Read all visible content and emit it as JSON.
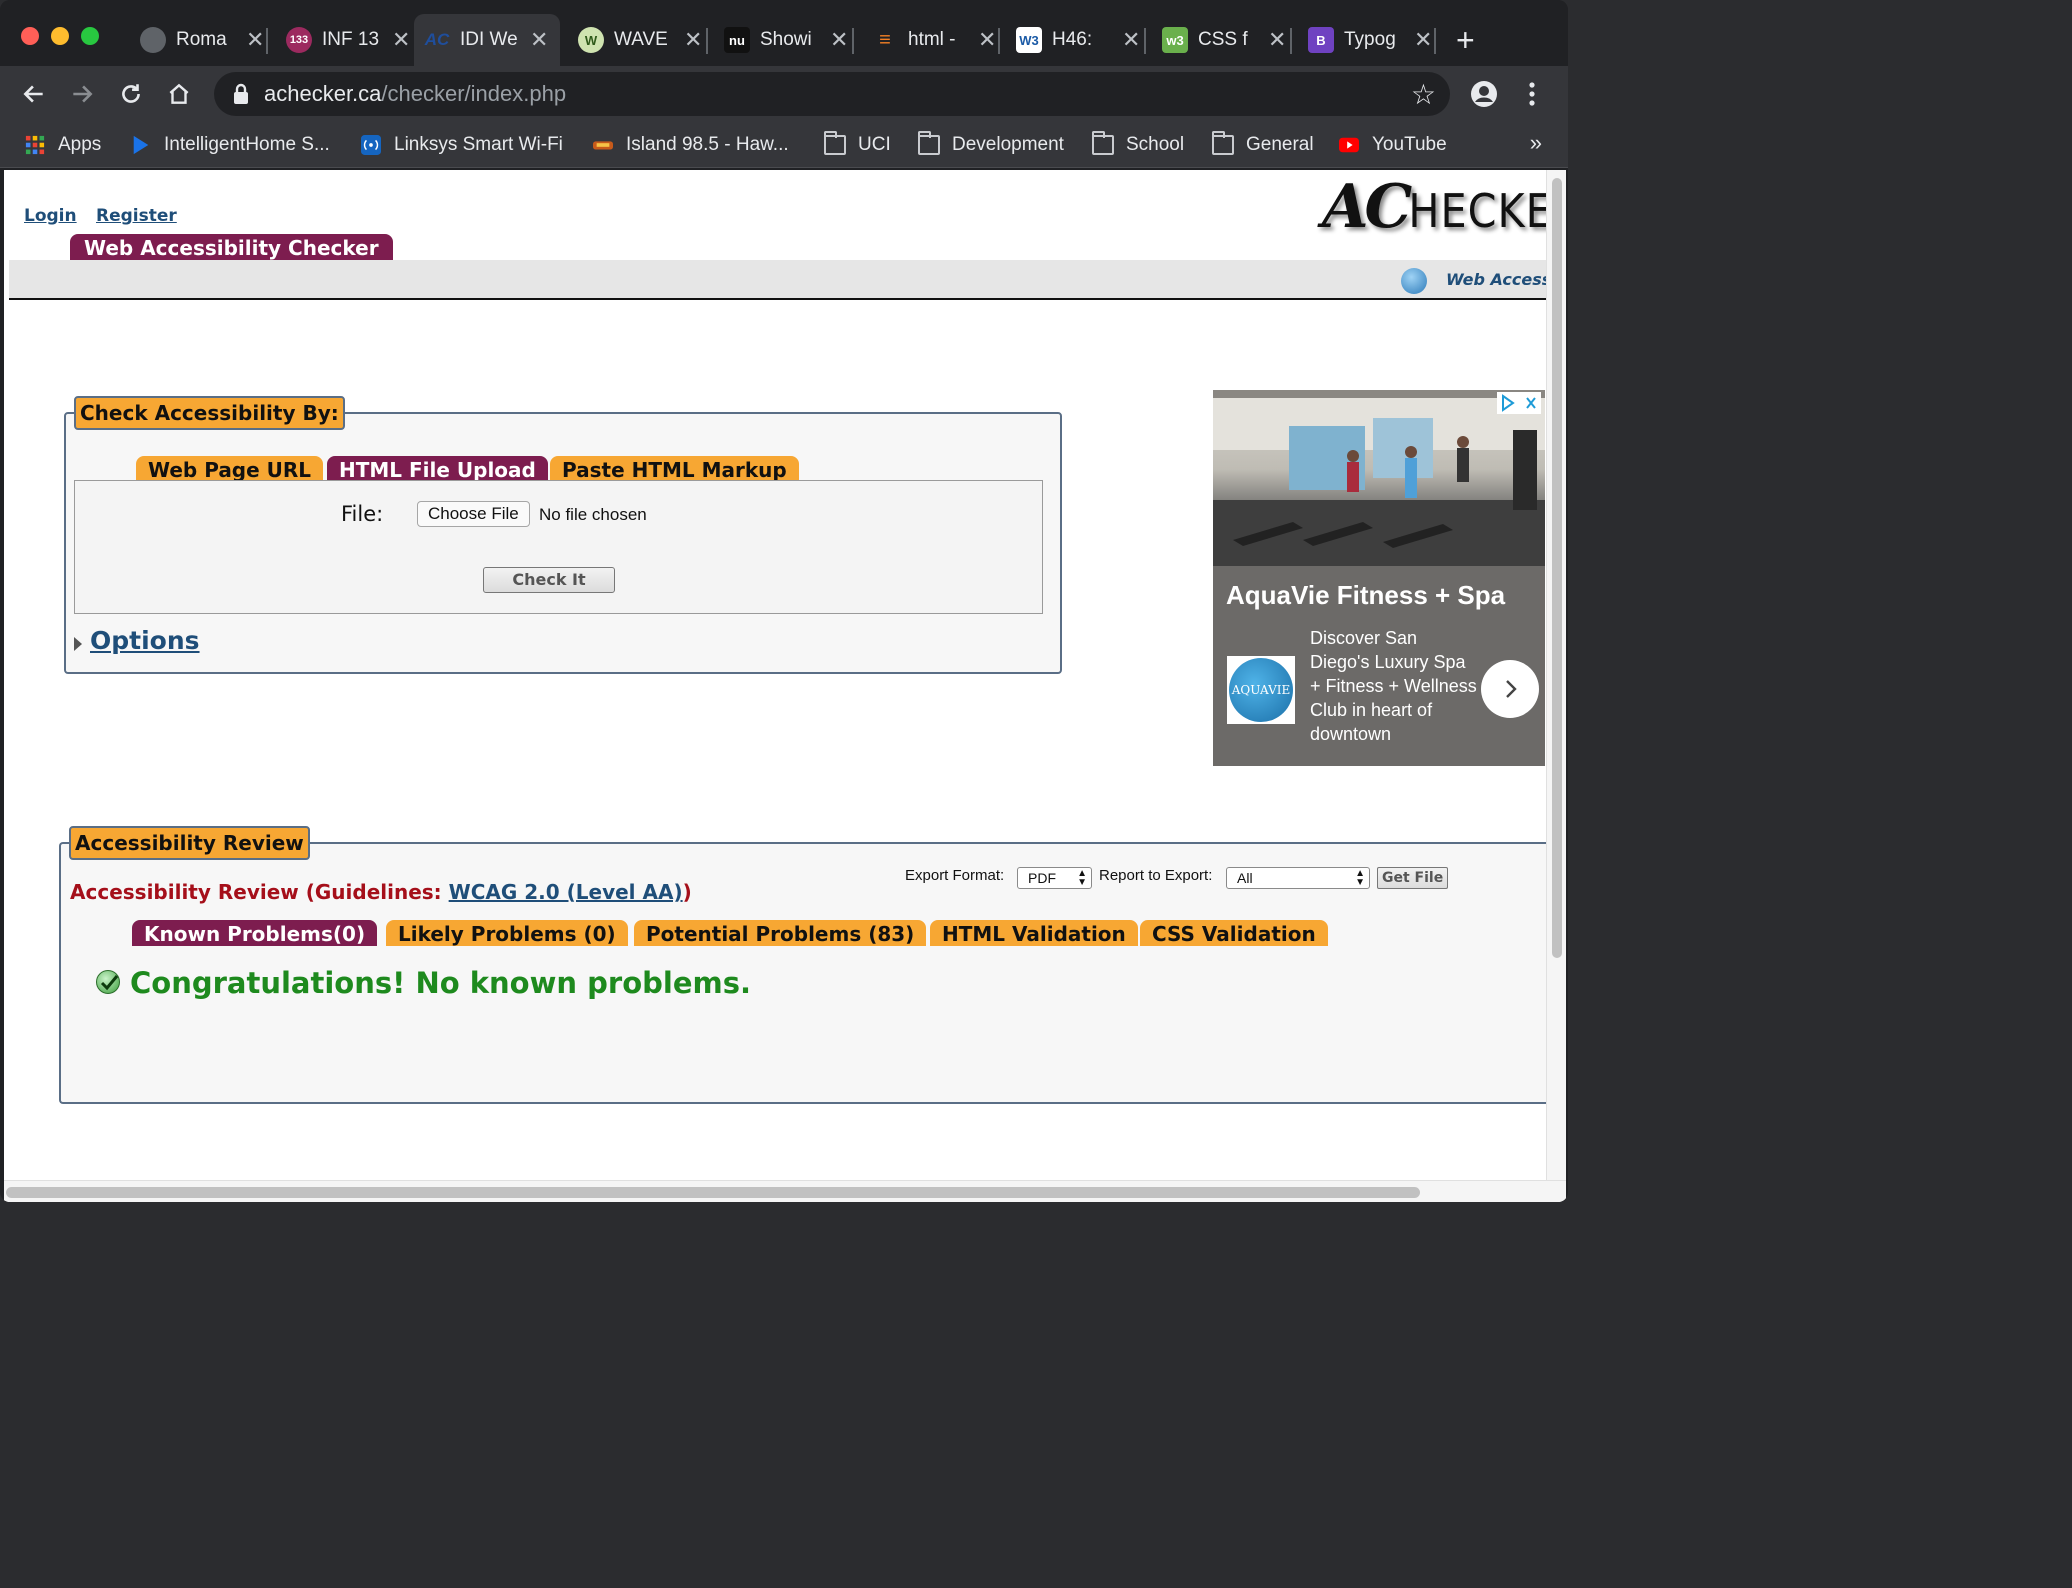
{
  "browser": {
    "tabs": [
      {
        "title": "Roma",
        "favicon": "globe-icon"
      },
      {
        "title": "INF 13",
        "favicon": "133-badge-icon",
        "badge": "133"
      },
      {
        "title": "IDI We",
        "favicon": "achecker-icon",
        "badge": "AC",
        "active": true
      },
      {
        "title": "WAVE",
        "favicon": "wave-icon",
        "badge": "W"
      },
      {
        "title": "Showi",
        "favicon": "nu-icon",
        "badge": "nu"
      },
      {
        "title": "html -",
        "favicon": "stackoverflow-icon"
      },
      {
        "title": "H46:",
        "favicon": "w3c-icon",
        "badge": "W3"
      },
      {
        "title": "CSS f",
        "favicon": "css-validator-icon",
        "badge": "w3"
      },
      {
        "title": "Typog",
        "favicon": "bootstrap-icon",
        "badge": "B"
      }
    ],
    "url_host": "achecker.ca",
    "url_path": "/checker/index.php",
    "bookmarks": [
      {
        "label": "Apps",
        "icon": "apps-grid-icon"
      },
      {
        "label": "IntelligentHome S...",
        "icon": "play-arrow-icon"
      },
      {
        "label": "Linksys Smart Wi-Fi",
        "icon": "wifi-icon"
      },
      {
        "label": "Island 98.5 - Haw...",
        "icon": "radio-icon"
      },
      {
        "label": "UCI",
        "icon": "folder-icon"
      },
      {
        "label": "Development",
        "icon": "folder-icon"
      },
      {
        "label": "School",
        "icon": "folder-icon"
      },
      {
        "label": "General",
        "icon": "folder-icon"
      },
      {
        "label": "YouTube",
        "icon": "youtube-icon"
      }
    ],
    "bookmarks_more": "»"
  },
  "page": {
    "login": "Login",
    "register": "Register",
    "logo_big": "AC",
    "logo_rest": "HECKE",
    "site_tab": "Web Accessibility Checker",
    "help_link": "Web Accessil",
    "check_legend": "Check Accessibility By:",
    "check_tabs": [
      "Web Page URL",
      "HTML File Upload",
      "Paste HTML Markup"
    ],
    "file_label": "File:",
    "choose_file": "Choose File",
    "no_file": "No file chosen",
    "check_it": "Check It",
    "options": "Options",
    "ad": {
      "title": "AquaVie Fitness + Spa",
      "logo_text": "AQUAVIE",
      "text": "Discover San Diego's Luxury Spa + Fitness + Wellness Club in heart of downtown"
    },
    "review_legend": "Accessibility Review",
    "review_heading_prefix": "Accessibility Review (Guidelines: ",
    "review_guideline": "WCAG 2.0 (Level AA)",
    "review_heading_suffix": ")",
    "export_format_label": "Export Format:",
    "export_format_value": "PDF",
    "report_label": "Report to Export:",
    "report_value": "All",
    "get_file": "Get File",
    "review_tabs": [
      "Known Problems(0)",
      "Likely Problems (0)",
      "Potential Problems (83)",
      "HTML Validation",
      "CSS Validation"
    ],
    "congrats": "Congratulations! No known problems."
  },
  "colors": {
    "tab_orange": "#f7a733",
    "tab_purple": "#7d1d4f",
    "link_blue": "#1f4e79",
    "heading_red": "#a50f1a",
    "success_green": "#1e8a1e"
  }
}
